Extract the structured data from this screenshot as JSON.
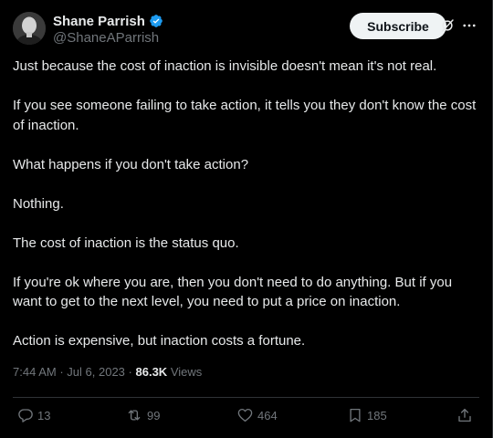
{
  "author": {
    "display_name": "Shane Parrish",
    "handle": "@ShaneAParrish",
    "verified": true
  },
  "header": {
    "subscribe_label": "Subscribe",
    "icons": [
      "grok-icon",
      "more-icon"
    ]
  },
  "post": {
    "paragraphs": [
      "Just because the cost of inaction is invisible doesn't mean it's not real.",
      "If you see someone failing to take action, it tells you they don't know the cost of inaction.",
      "What happens if you don't take action?",
      "Nothing.",
      "The cost of inaction is the status quo.",
      "If you're ok where you are, then you don't need to do anything. But if you want to get to the next level, you need to put a price on inaction.",
      "Action is expensive, but inaction costs a fortune."
    ],
    "time": "7:44 AM",
    "date": "Jul 6, 2023",
    "separator": "·",
    "views_count": "86.3K",
    "views_label": "Views"
  },
  "actions": {
    "replies": "13",
    "reposts": "99",
    "likes": "464",
    "bookmarks": "185"
  },
  "colors": {
    "background": "#000000",
    "text": "#e7e9ea",
    "muted": "#71767b",
    "verified": "#1d9bf0",
    "divider": "#2f3336",
    "button_bg": "#eff3f4"
  }
}
